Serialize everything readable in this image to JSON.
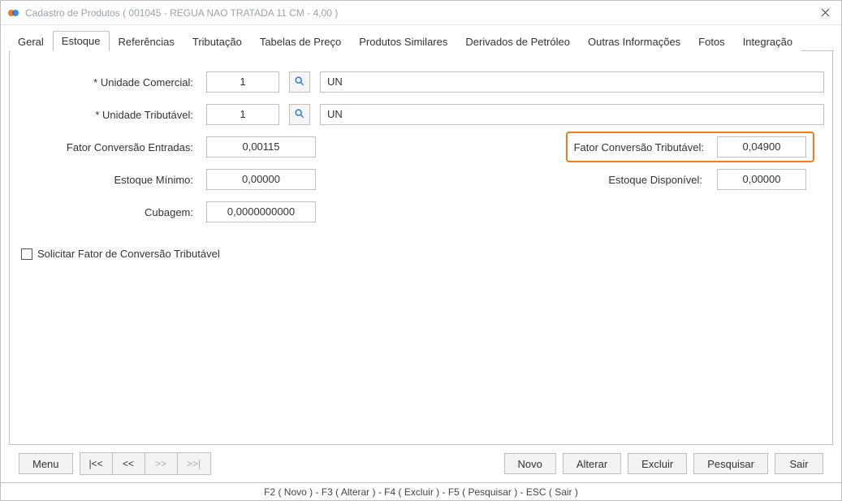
{
  "window": {
    "title": "Cadastro de Produtos ( 001045 - REGUA NAO TRATADA 11 CM - 4,00 )"
  },
  "tabs": {
    "geral": "Geral",
    "estoque": "Estoque",
    "referencias": "Referências",
    "tributacao": "Tributação",
    "tabelas_preco": "Tabelas de Preço",
    "produtos_similares": "Produtos Similares",
    "derivados_petroleo": "Derivados de Petróleo",
    "outras_info": "Outras Informações",
    "fotos": "Fotos",
    "integracao": "Integração"
  },
  "form": {
    "unidade_comercial_label": "* Unidade Comercial:",
    "unidade_comercial_code": "1",
    "unidade_comercial_text": "UN",
    "unidade_tributavel_label": "* Unidade Tributável:",
    "unidade_tributavel_code": "1",
    "unidade_tributavel_text": "UN",
    "fator_entradas_label": "Fator Conversão Entradas:",
    "fator_entradas_value": "0,00115",
    "fator_tributavel_label": "Fator Conversão Tributável:",
    "fator_tributavel_value": "0,04900",
    "estoque_minimo_label": "Estoque Mínimo:",
    "estoque_minimo_value": "0,00000",
    "estoque_disponivel_label": "Estoque Disponível:",
    "estoque_disponivel_value": "0,00000",
    "cubagem_label": "Cubagem:",
    "cubagem_value": "0,0000000000",
    "checkbox_label": "Solicitar Fator de Conversão Tributável"
  },
  "buttons": {
    "menu": "Menu",
    "first": "|<<",
    "prev": "<<",
    "next": ">>",
    "last": ">>|",
    "novo": "Novo",
    "alterar": "Alterar",
    "excluir": "Excluir",
    "pesquisar": "Pesquisar",
    "sair": "Sair"
  },
  "status": "F2 ( Novo )  -  F3 ( Alterar )  -  F4 ( Excluir )  -  F5 ( Pesquisar )  -  ESC ( Sair )"
}
